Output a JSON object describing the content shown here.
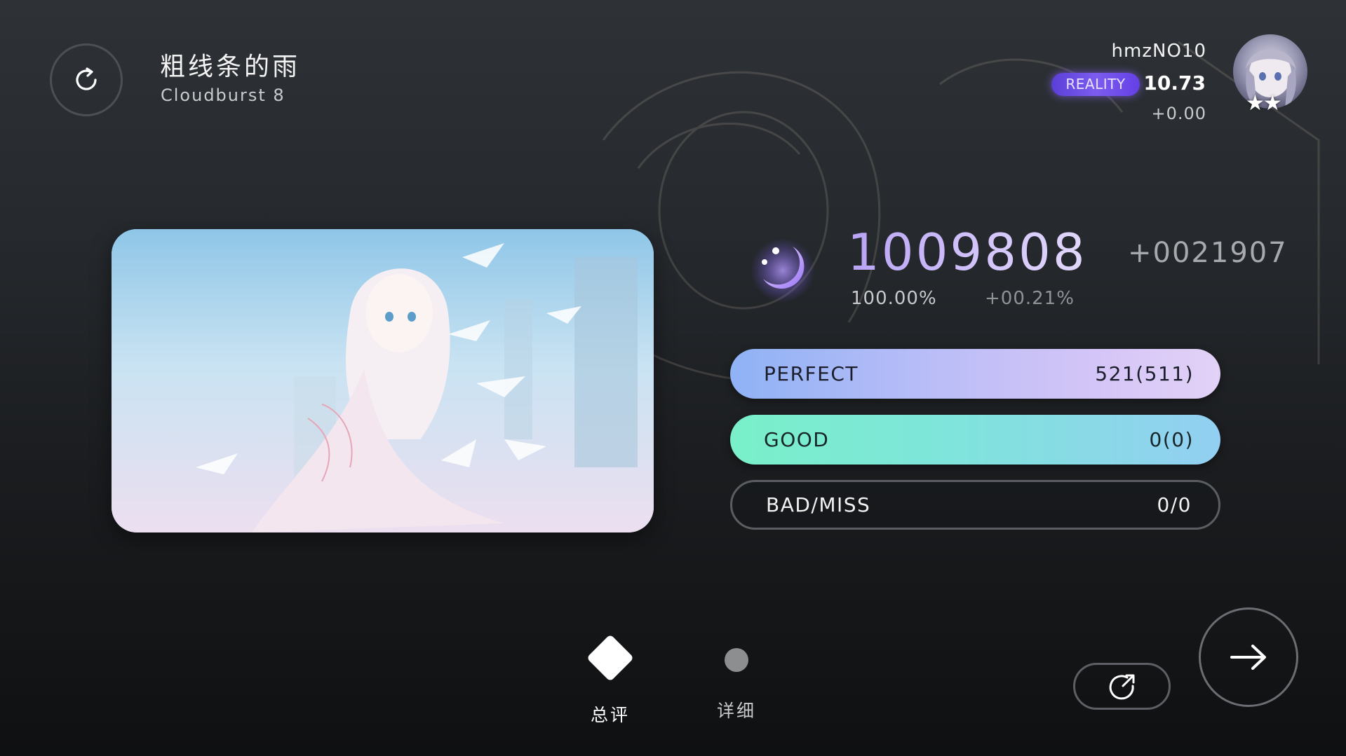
{
  "song": {
    "title": "粗线条的雨",
    "level": "Cloudburst 8"
  },
  "player": {
    "name": "hmzNO10",
    "badge": "REALITY",
    "rks": "10.73",
    "rks_delta": "+0.00",
    "stars": "★★"
  },
  "result": {
    "score": "1009808",
    "score_delta": "+0021907",
    "accuracy": "100.00%",
    "accuracy_delta": "+00.21%"
  },
  "judgements": {
    "perfect": {
      "label": "PERFECT",
      "value": "521(511)"
    },
    "good": {
      "label": "GOOD",
      "value": "0(0)"
    },
    "bad_miss": {
      "label": "BAD/MISS",
      "value": "0/0"
    }
  },
  "tabs": {
    "summary": "总评",
    "detail": "详细"
  },
  "icons": {
    "retry": "retry-icon",
    "rank": "moon-rank-icon",
    "share": "share-icon",
    "next": "arrow-right-icon"
  },
  "colors": {
    "score_accent": "#c9b4f7",
    "perfect_start": "#8fb2f6",
    "perfect_end": "#e2d2f7",
    "good_start": "#79f0c9",
    "good_end": "#93cff2",
    "badge": "#6a4ce8"
  }
}
